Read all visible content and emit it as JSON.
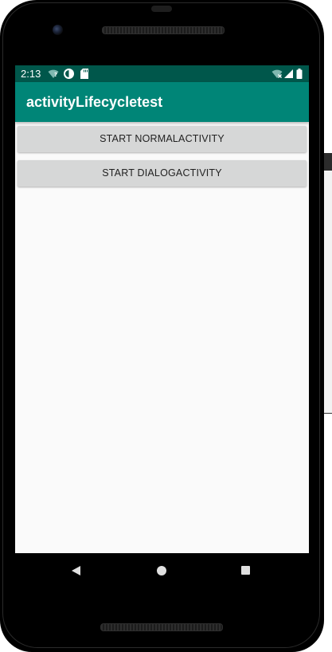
{
  "status_bar": {
    "time": "2:13",
    "left_icons": [
      "wifi-question-icon",
      "data-saver-icon",
      "sd-card-icon"
    ],
    "right_icons": [
      "wifi-x-icon",
      "signal-icon",
      "battery-icon"
    ]
  },
  "app_bar": {
    "title": "activityLifecycletest"
  },
  "buttons": {
    "start_normal": "START NORMALACTIVITY",
    "start_dialog": "START DIALOGACTIVITY"
  },
  "navigation": [
    "back-icon",
    "home-icon",
    "recents-icon"
  ],
  "colors": {
    "status_bar": "#00574b",
    "app_bar": "#008577",
    "button": "#d6d7d7",
    "screen_bg": "#fafafa"
  }
}
